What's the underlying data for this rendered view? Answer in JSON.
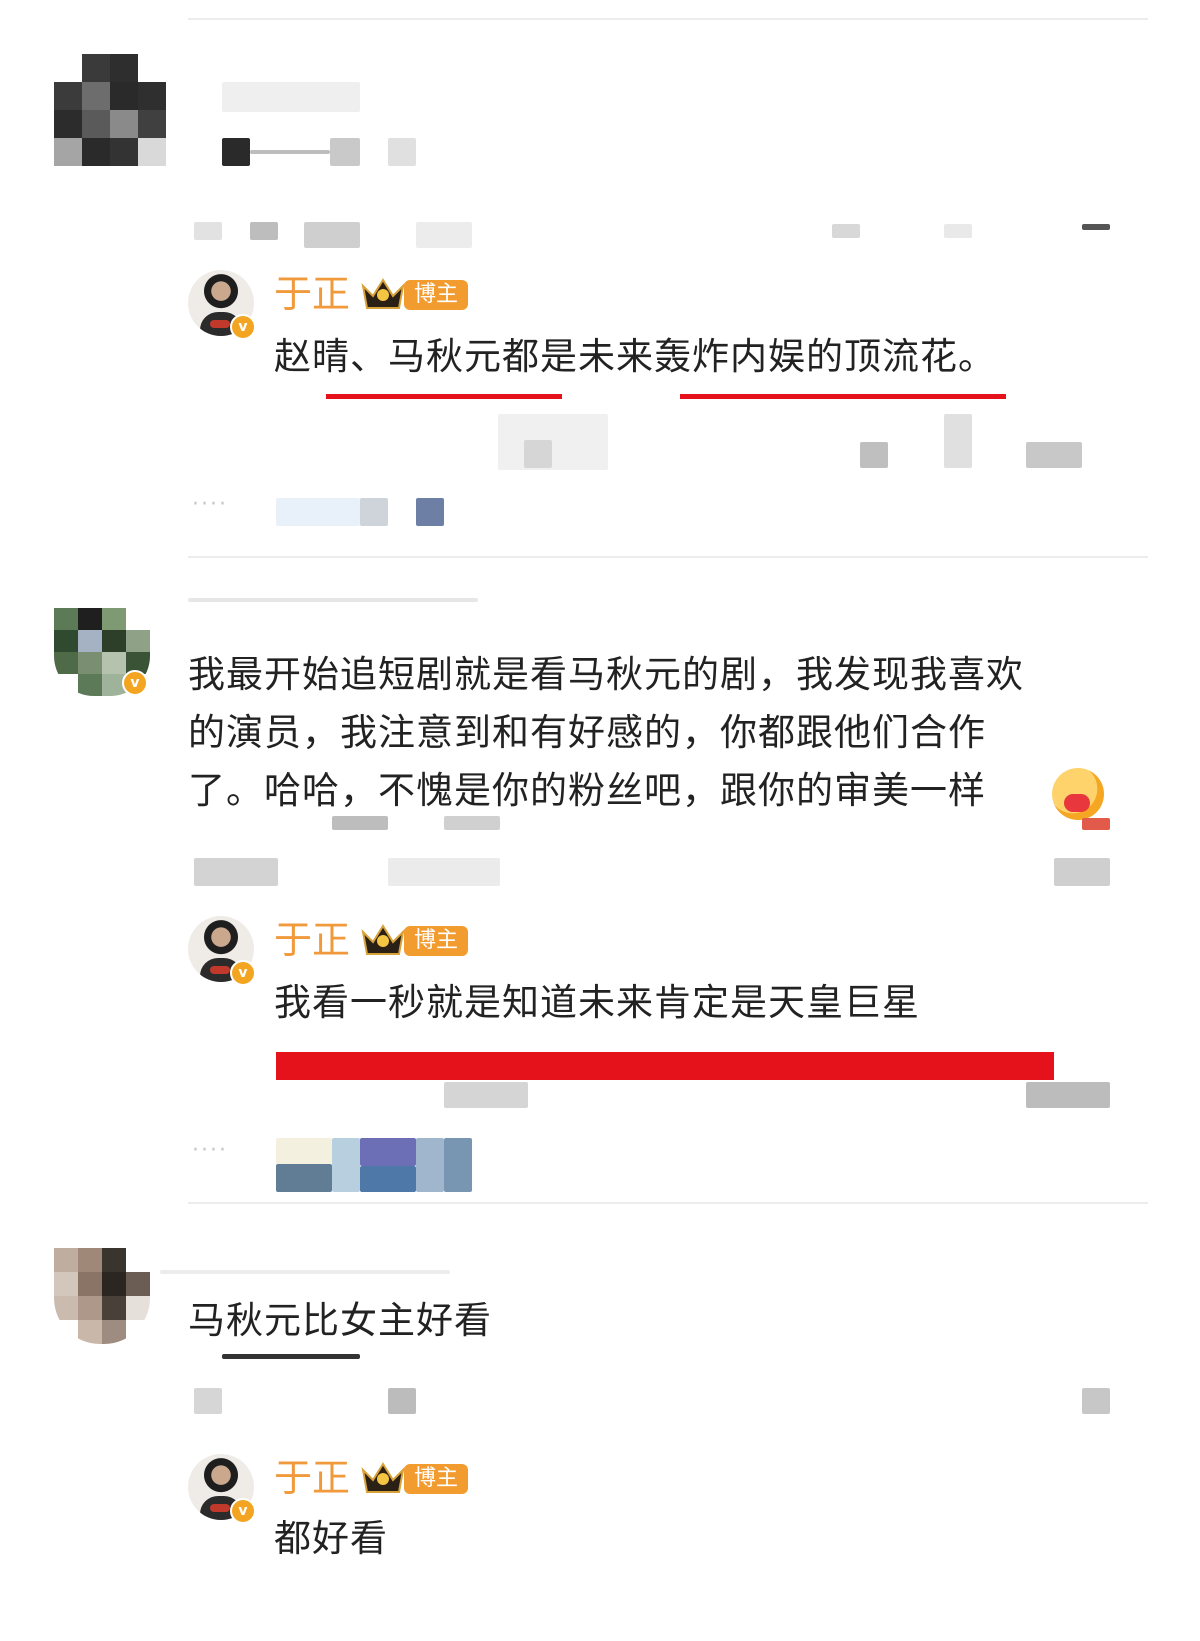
{
  "thread": {
    "comment1": {
      "reply": {
        "author": "于正",
        "badge": "博主",
        "text": "赵晴、马秋元都是未来轰炸内娱的顶流花。"
      }
    },
    "comment2": {
      "text_lines": [
        "我最开始追短剧就是看马秋元的剧，我发现我喜欢",
        "的演员，我注意到和有好感的，你都跟他们合作",
        "了。哈哈，不愧是你的粉丝吧，跟你的审美一样"
      ],
      "reply": {
        "author": "于正",
        "badge": "博主",
        "text": "我看一秒就是知道未来肯定是天皇巨星"
      }
    },
    "comment3": {
      "text": "马秋元比女主好看",
      "reply": {
        "author": "于正",
        "badge": "博主",
        "text": "都好看"
      }
    },
    "more_icon": "····",
    "verified_icon": "v",
    "colors": {
      "author": "#f09a3c",
      "badge": "#f29b2f",
      "verified": "#f3a521",
      "highlight_line": "#e5121b"
    }
  }
}
